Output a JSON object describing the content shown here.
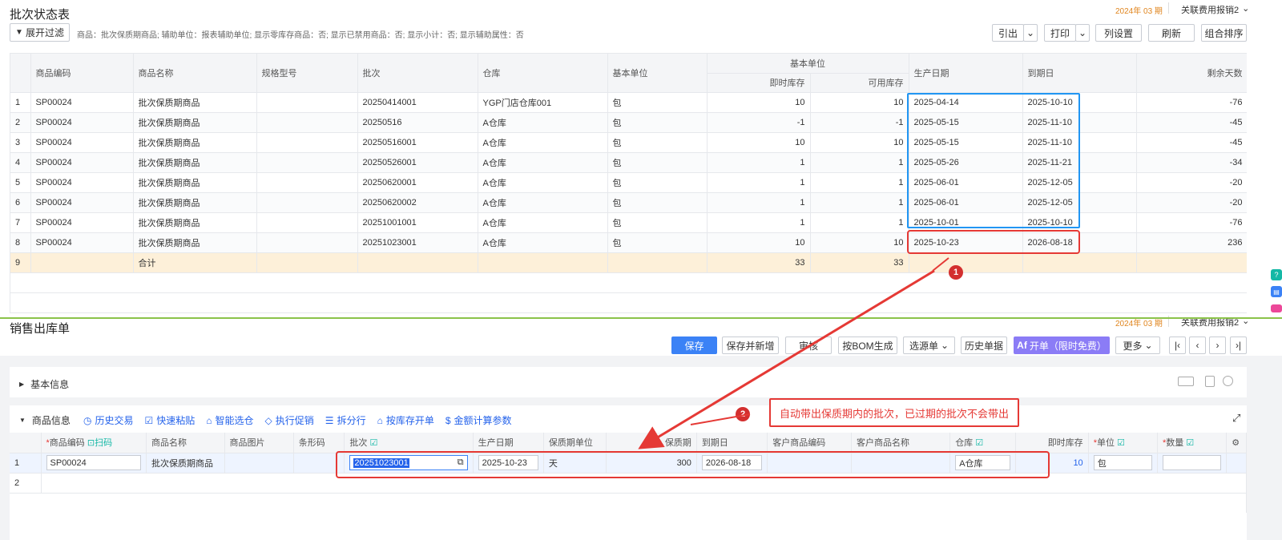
{
  "top": {
    "title": "批次状态表",
    "period": "2024年 03 期",
    "assoc": "关联费用报销2",
    "filter_btn": "展开过滤",
    "filter_text": "商品：批次保质期商品; 辅助单位：报表辅助单位; 显示零库存商品：否; 显示已禁用商品：否; 显示小计：否; 显示辅助属性：否",
    "buttons": {
      "export": "引出",
      "print": "打印",
      "columns": "列设置",
      "refresh": "刷新",
      "sort": "组合排序"
    },
    "columns": [
      "商品编码",
      "商品名称",
      "规格型号",
      "批次",
      "仓库",
      "基本单位",
      "基本单位",
      "即时库存",
      "可用库存",
      "生产日期",
      "到期日",
      "剩余天数"
    ],
    "rows": [
      [
        "1",
        "SP00024",
        "批次保质期商品",
        "",
        "20250414001",
        "YGP门店仓库001",
        "包",
        "10",
        "10",
        "2025-04-14",
        "2025-10-10",
        "-76"
      ],
      [
        "2",
        "SP00024",
        "批次保质期商品",
        "",
        "20250516",
        "A仓库",
        "包",
        "-1",
        "-1",
        "2025-05-15",
        "2025-11-10",
        "-45"
      ],
      [
        "3",
        "SP00024",
        "批次保质期商品",
        "",
        "20250516001",
        "A仓库",
        "包",
        "10",
        "10",
        "2025-05-15",
        "2025-11-10",
        "-45"
      ],
      [
        "4",
        "SP00024",
        "批次保质期商品",
        "",
        "20250526001",
        "A仓库",
        "包",
        "1",
        "1",
        "2025-05-26",
        "2025-11-21",
        "-34"
      ],
      [
        "5",
        "SP00024",
        "批次保质期商品",
        "",
        "20250620001",
        "A仓库",
        "包",
        "1",
        "1",
        "2025-06-01",
        "2025-12-05",
        "-20"
      ],
      [
        "6",
        "SP00024",
        "批次保质期商品",
        "",
        "20250620002",
        "A仓库",
        "包",
        "1",
        "1",
        "2025-06-01",
        "2025-12-05",
        "-20"
      ],
      [
        "7",
        "SP00024",
        "批次保质期商品",
        "",
        "20251001001",
        "A仓库",
        "包",
        "1",
        "1",
        "2025-10-01",
        "2025-10-10",
        "-76"
      ],
      [
        "8",
        "SP00024",
        "批次保质期商品",
        "",
        "20251023001",
        "A仓库",
        "包",
        "10",
        "10",
        "2025-10-23",
        "2026-08-18",
        "236"
      ]
    ],
    "total": {
      "index": "9",
      "label": "合计",
      "qty": "33",
      "avail": "33"
    }
  },
  "bottom": {
    "title": "销售出库单",
    "period": "2024年 03 期",
    "assoc": "关联费用报销2",
    "buttons": {
      "save": "保存",
      "save_new": "保存并新增",
      "audit": "审核",
      "bom": "按BOM生成",
      "source": "选源单",
      "history": "历史单据",
      "invoice": "开单（限时免费）",
      "more": "更多"
    },
    "basic_info": "基本信息",
    "goods_info": "商品信息",
    "tools": [
      "历史交易",
      "快速粘贴",
      "智能选仓",
      "执行促销",
      "拆分行",
      "按库存开单",
      "金额计算参数"
    ],
    "annotation": "自动带出保质期内的批次，已过期的批次不会带出",
    "columns": {
      "code": "商品编码",
      "scan": "扫码",
      "name": "商品名称",
      "image": "商品图片",
      "barcode": "条形码",
      "batch": "批次",
      "prod_date": "生产日期",
      "shelf_unit": "保质期单位",
      "shelf": "保质期",
      "expiry": "到期日",
      "cust_code": "客户商品编码",
      "cust_name": "客户商品名称",
      "warehouse": "仓库",
      "stock": "即时库存",
      "unit": "单位",
      "qty": "数量"
    },
    "row": {
      "index": "1",
      "code": "SP00024",
      "name": "批次保质期商品",
      "batch": "20251023001",
      "prod_date": "2025-10-23",
      "shelf_unit": "天",
      "shelf": "300",
      "expiry": "2026-08-18",
      "warehouse": "A仓库",
      "stock": "10",
      "unit": "包"
    },
    "row2_index": "2"
  },
  "badges": {
    "one": "1",
    "two": "2"
  },
  "colors": {
    "primary": "#3b82f6",
    "annotation_red": "#e53935",
    "highlight_blue": "#2196f3"
  }
}
